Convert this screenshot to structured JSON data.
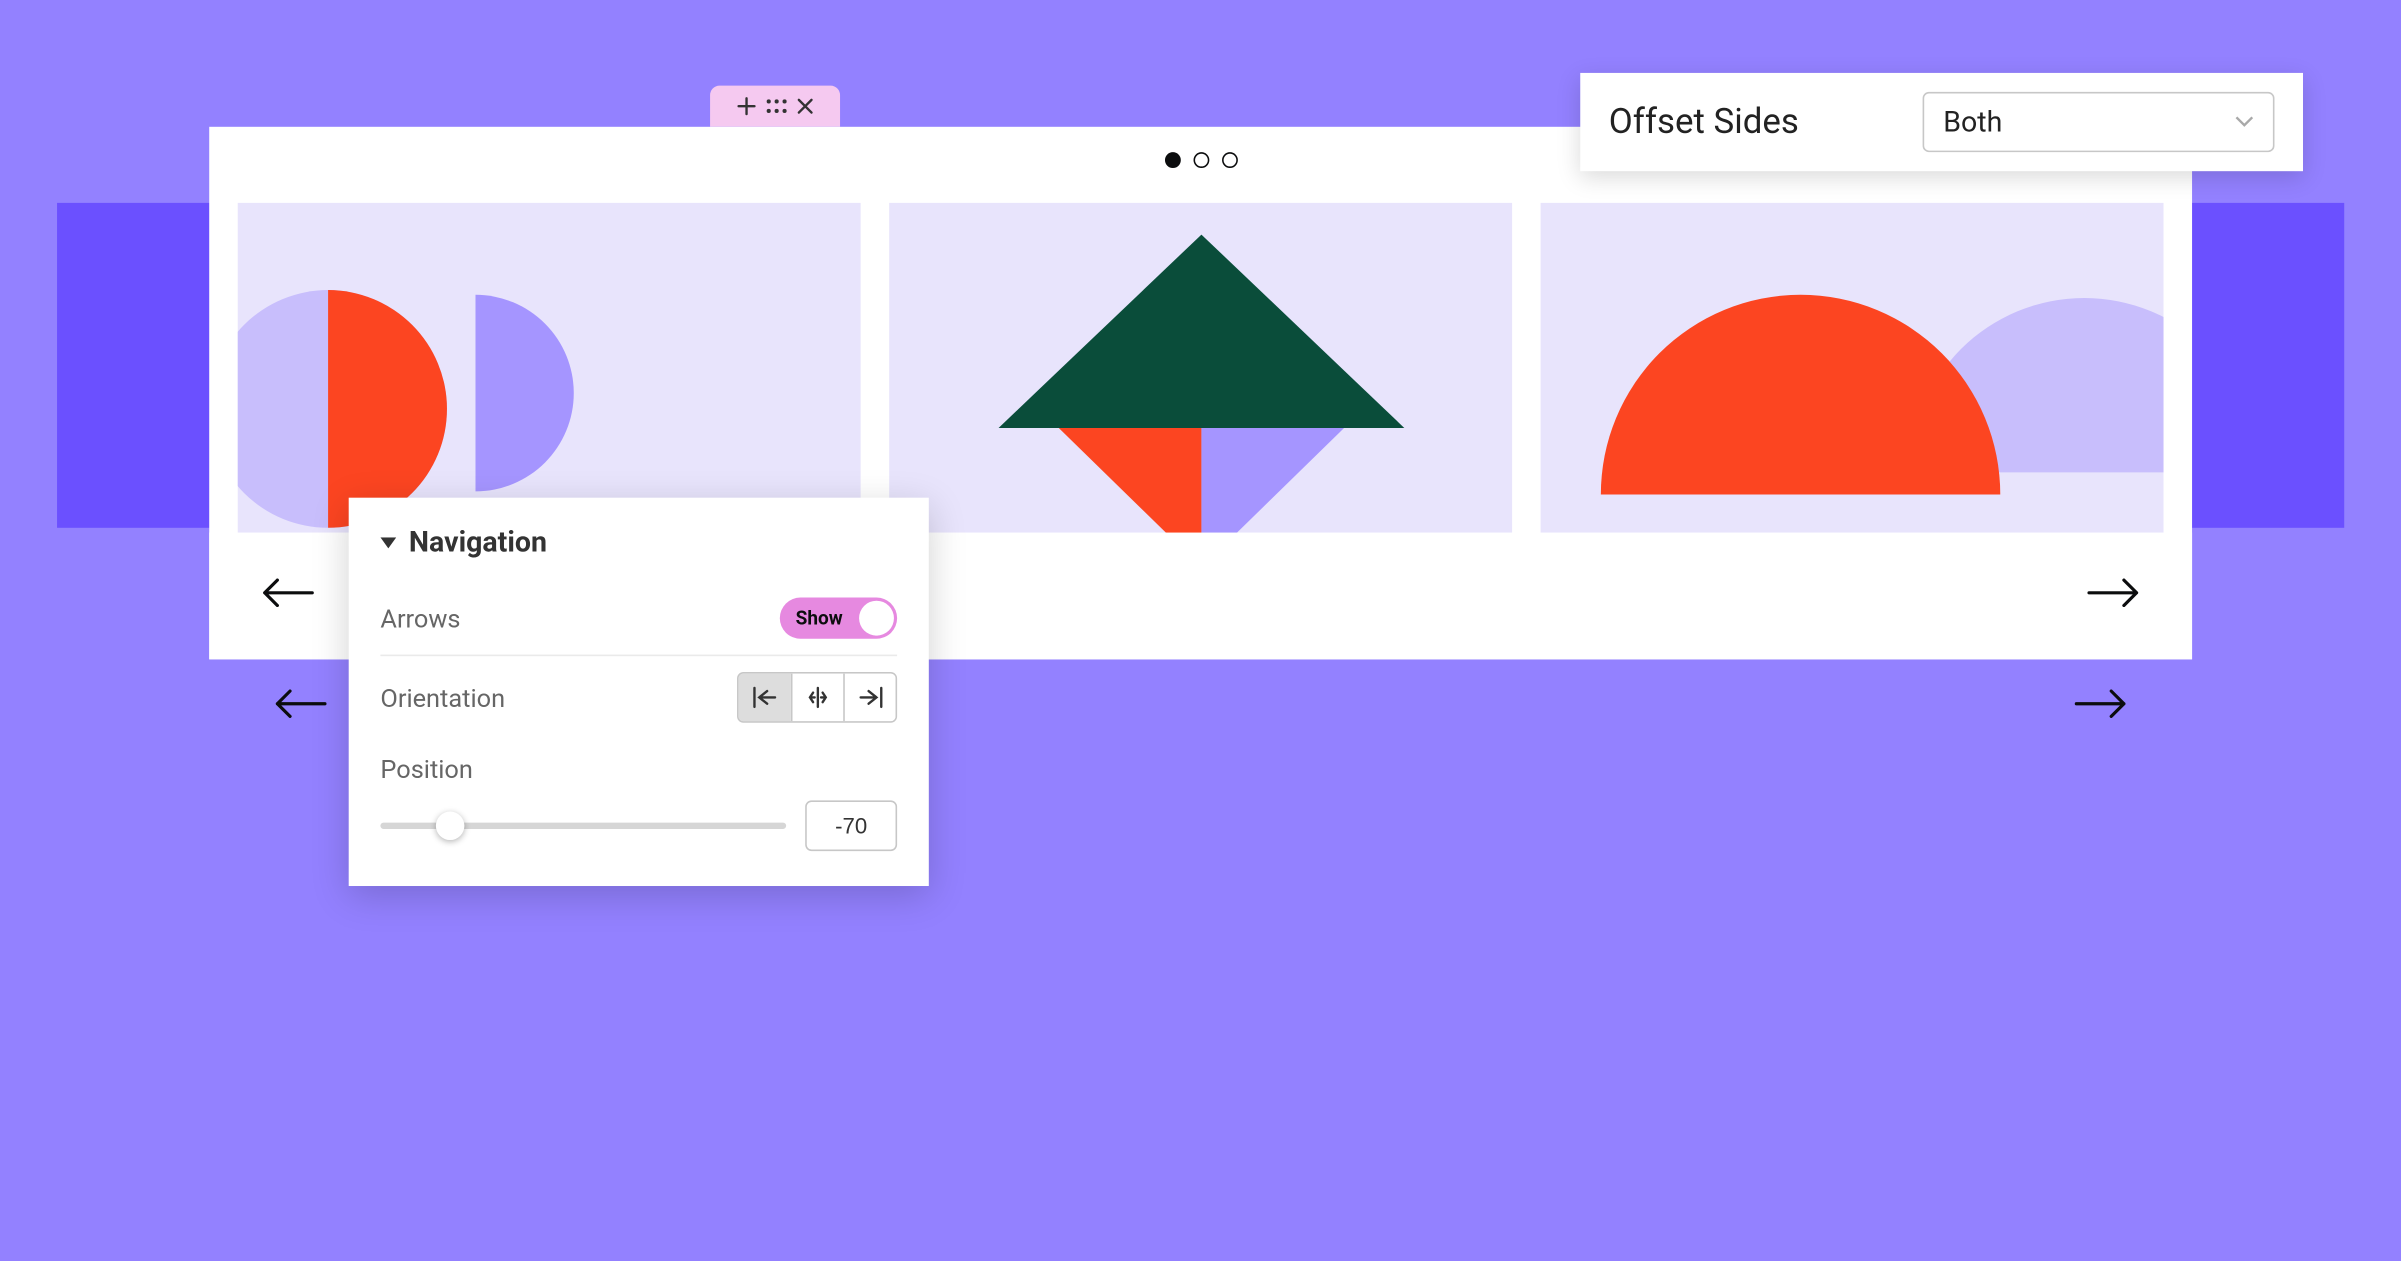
{
  "colors": {
    "bg": "#9381ff",
    "bg_band": "#6b50ff",
    "slide_bg": "#e8e4fc",
    "orange": "#fc4521",
    "green": "#0a4d3a",
    "lavender": "#a595ff",
    "light_lavender": "#c8befc",
    "pink": "#e689e0"
  },
  "editor_tab": {
    "icons": [
      "plus",
      "drag",
      "close"
    ]
  },
  "pagination": {
    "count": 3,
    "active_index": 0
  },
  "offset_panel": {
    "label": "Offset Sides",
    "selected": "Both"
  },
  "nav_panel": {
    "title": "Navigation",
    "rows": {
      "arrows": {
        "label": "Arrows",
        "toggle_text": "Show",
        "state": true
      },
      "orientation": {
        "label": "Orientation",
        "options": [
          "left",
          "center",
          "right"
        ],
        "active_index": 0
      },
      "position": {
        "label": "Position",
        "value": "-70"
      }
    }
  },
  "arrows": {
    "prev": "prev",
    "next": "next"
  }
}
